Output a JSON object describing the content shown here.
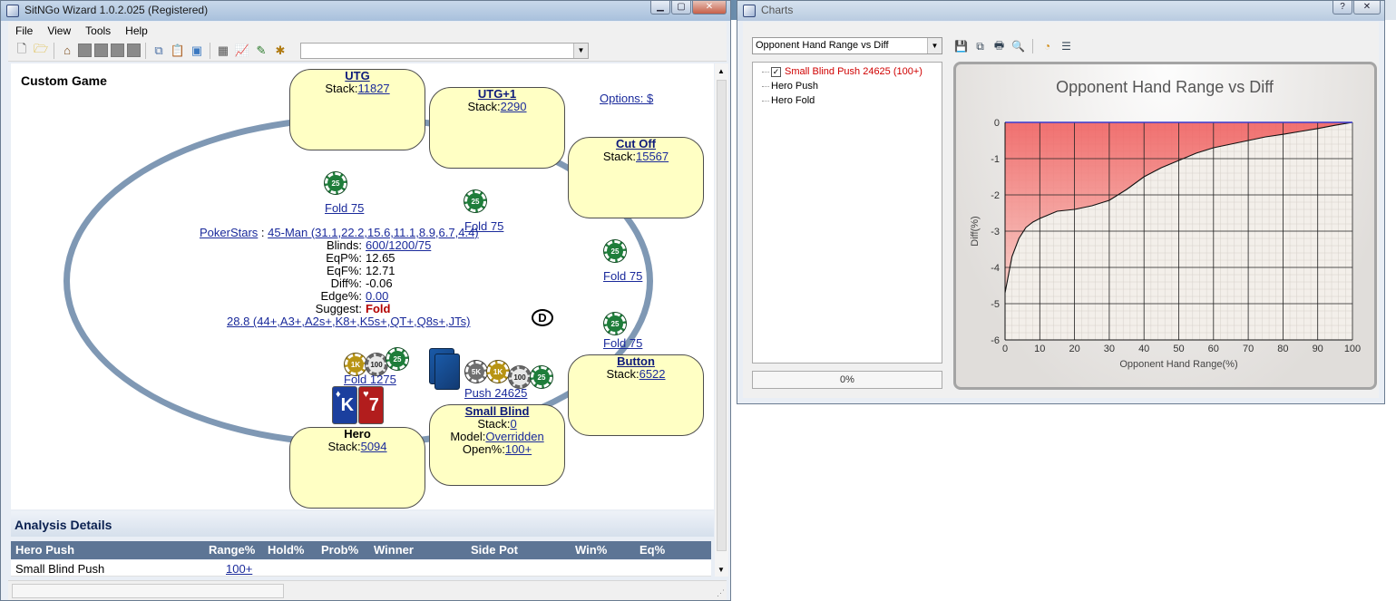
{
  "main_window": {
    "title": "SitNGo Wizard 1.0.2.025 (Registered)",
    "menu": [
      "File",
      "View",
      "Tools",
      "Help"
    ],
    "game_title": "Custom Game",
    "options_link": "Options: $",
    "seats": [
      {
        "name": "UTG",
        "stack_label": "Stack:",
        "stack": "11827"
      },
      {
        "name": "UTG+1",
        "stack_label": "Stack:",
        "stack": "2290"
      },
      {
        "name": "Cut Off",
        "stack_label": "Stack:",
        "stack": "15567"
      },
      {
        "name": "Button",
        "stack_label": "Stack:",
        "stack": "6522"
      },
      {
        "name": "Small Blind",
        "stack_label": "Stack:",
        "stack": "0",
        "model_label": "Model:",
        "model": "Overridden",
        "open_label": "Open%:",
        "open": "100+"
      },
      {
        "name": "Hero",
        "stack_label": "Stack:",
        "stack": "5094"
      }
    ],
    "bets": {
      "utg": "Fold 75",
      "utg1": "Fold 75",
      "cutoff": "Fold 75",
      "button": "Fold 75",
      "hero": "Fold 1275",
      "small_blind": "Push 24625"
    },
    "chip_labels": {
      "c25": "25",
      "c100": "100",
      "c1k": "1K",
      "c5k": "5K"
    },
    "dealer": "D",
    "info": {
      "site": "PokerStars",
      "sep": " : ",
      "structure": "45-Man (31.1,22.2,15.6,11.1,8.9,6.7,4.4)",
      "blinds_label": "Blinds:",
      "blinds": "600/1200/75",
      "eqp_label": "EqP%:",
      "eqp": "12.65",
      "eqf_label": "EqF%:",
      "eqf": "12.71",
      "diff_label": "Diff%:",
      "diff": "-0.06",
      "edge_label": "Edge%:",
      "edge": "0.00",
      "suggest_label": "Suggest:",
      "suggest": "Fold",
      "range": "28.8 (44+,A3+,A2s+,K8+,K5s+,QT+,Q8s+,JTs)"
    },
    "hero_cards": [
      {
        "rank": "K",
        "suit": "♦",
        "color": "#1b3f9e"
      },
      {
        "rank": "7",
        "suit": "♥",
        "color": "#b21d1d"
      }
    ],
    "analysis": {
      "heading": "Analysis Details",
      "columns": [
        "Hero Push",
        "Range%",
        "Hold%",
        "Prob%",
        "Winner",
        "Side Pot",
        "Win%",
        "Eq%"
      ],
      "rows": [
        {
          "label": "Small Blind Push",
          "range": "100+"
        }
      ]
    }
  },
  "charts_window": {
    "title": "Charts",
    "selector": "Opponent Hand Range vs Diff",
    "tree": [
      {
        "label": "Small Blind Push 24625 (100+)",
        "checked": true,
        "color": "#d00000"
      },
      {
        "label": "Hero Push",
        "checked": false
      },
      {
        "label": "Hero Fold",
        "checked": false
      }
    ],
    "check_glyph": "✓",
    "progress": "0%",
    "chart_data": {
      "type": "area",
      "title": "Opponent Hand Range vs Diff",
      "xlabel": "Opponent Hand Range(%)",
      "ylabel": "Diff(%)",
      "xlim": [
        0,
        100
      ],
      "ylim": [
        -6,
        0
      ],
      "xticks": [
        0,
        10,
        20,
        30,
        40,
        50,
        60,
        70,
        80,
        90,
        100
      ],
      "yticks": [
        0,
        -1,
        -2,
        -3,
        -4,
        -5,
        -6
      ],
      "grid": true,
      "series": [
        {
          "color": "#e23b3b",
          "x": [
            0,
            1,
            2,
            4,
            6,
            8,
            10,
            15,
            20,
            25,
            30,
            35,
            40,
            45,
            50,
            55,
            60,
            65,
            70,
            75,
            80,
            85,
            90,
            95,
            100
          ],
          "values": [
            -4.7,
            -4.2,
            -3.7,
            -3.2,
            -2.9,
            -2.75,
            -2.65,
            -2.45,
            -2.4,
            -2.3,
            -2.15,
            -1.85,
            -1.5,
            -1.25,
            -1.05,
            -0.85,
            -0.7,
            -0.6,
            -0.5,
            -0.4,
            -0.33,
            -0.25,
            -0.17,
            -0.08,
            0
          ]
        }
      ]
    }
  }
}
